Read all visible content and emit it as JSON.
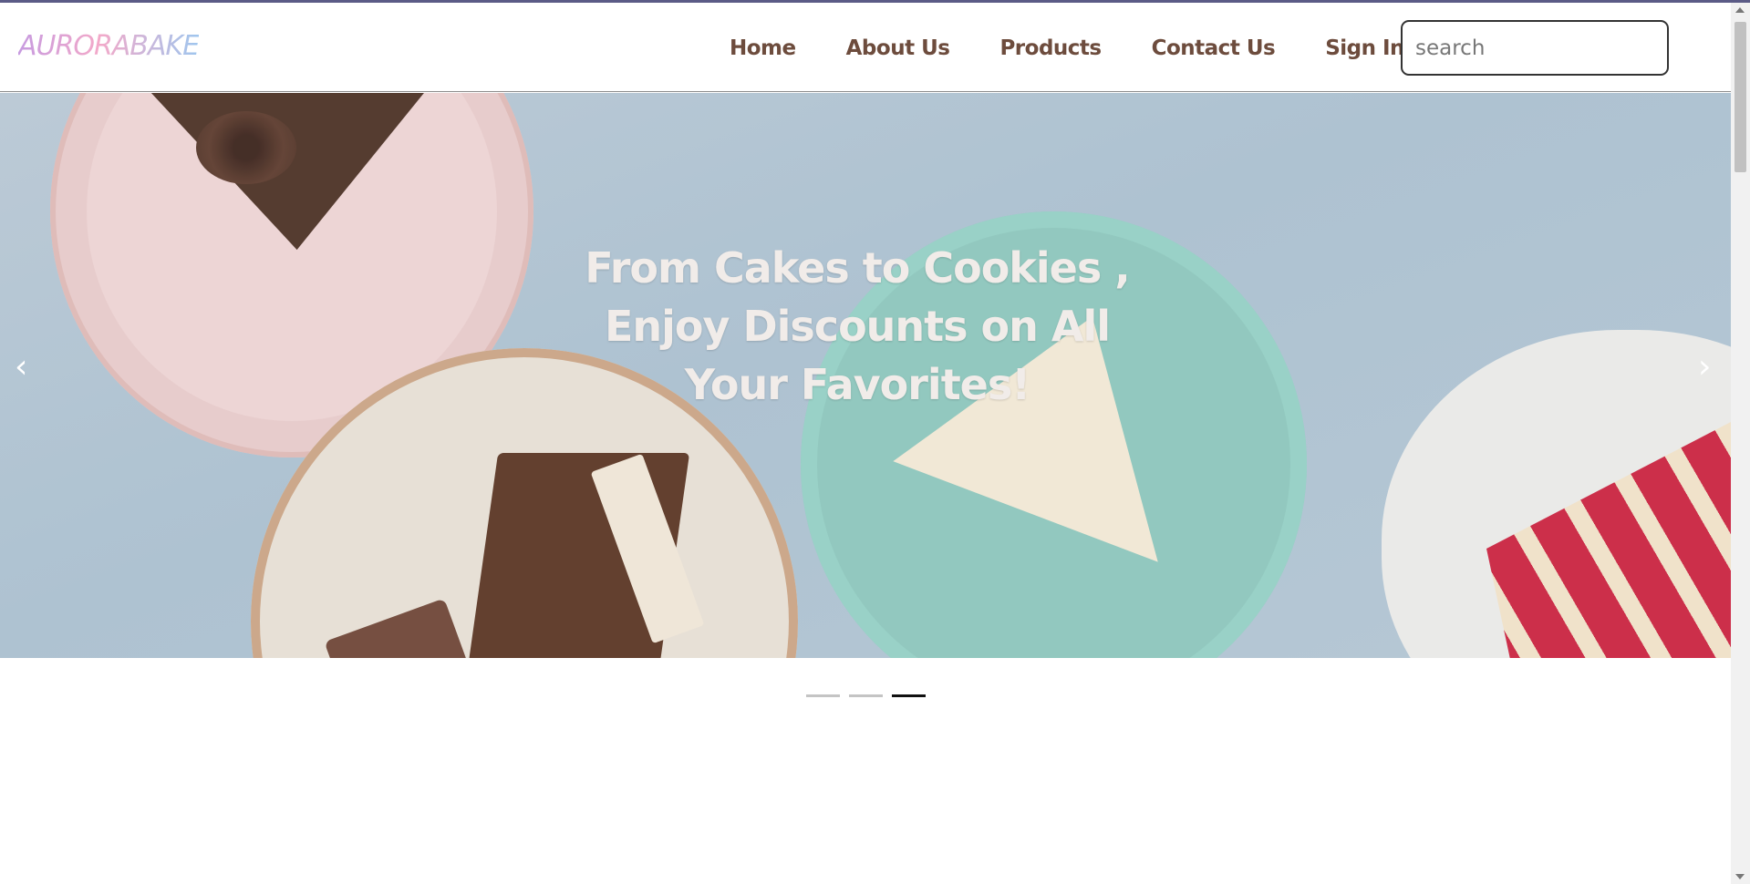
{
  "brand": {
    "logo_text": "AURORABAKE"
  },
  "nav": {
    "items": [
      {
        "label": "Home"
      },
      {
        "label": "About Us"
      },
      {
        "label": "Products"
      },
      {
        "label": "Contact Us"
      },
      {
        "label": "Sign In"
      }
    ]
  },
  "search": {
    "placeholder": "search",
    "value": ""
  },
  "hero": {
    "caption": "From Cakes to Cookies , Enjoy Discounts on All Your Favorites!",
    "prev_arrow": "‹",
    "next_arrow": "›",
    "image_subject": "slices of cake on plates",
    "total_slides": 3,
    "active_slide": 3
  },
  "colors": {
    "nav_text": "#6d4c3d",
    "indicator_active": "#111111",
    "indicator_inactive": "#c4c4c4"
  }
}
